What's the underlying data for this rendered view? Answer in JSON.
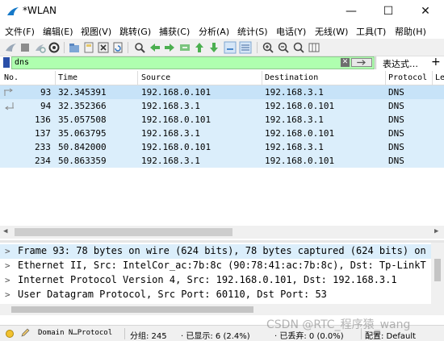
{
  "window": {
    "title": "*WLAN",
    "minimize": "—",
    "maximize": "☐",
    "close": "✕"
  },
  "menu": [
    {
      "label": "文件(F)"
    },
    {
      "label": "编辑(E)"
    },
    {
      "label": "视图(V)"
    },
    {
      "label": "跳转(G)"
    },
    {
      "label": "捕获(C)"
    },
    {
      "label": "分析(A)"
    },
    {
      "label": "统计(S)"
    },
    {
      "label": "电话(Y)"
    },
    {
      "label": "无线(W)"
    },
    {
      "label": "工具(T)"
    },
    {
      "label": "帮助(H)"
    }
  ],
  "filter": {
    "value": "dns",
    "expression_label": "表达式…",
    "plus": "+",
    "clear": "✕"
  },
  "columns": {
    "no": "No.",
    "time": "Time",
    "source": "Source",
    "destination": "Destination",
    "protocol": "Protocol",
    "length": "Le"
  },
  "packets": [
    {
      "no": "93",
      "time": "32.345391",
      "source": "192.168.0.101",
      "destination": "192.168.3.1",
      "protocol": "DNS"
    },
    {
      "no": "94",
      "time": "32.352366",
      "source": "192.168.3.1",
      "destination": "192.168.0.101",
      "protocol": "DNS"
    },
    {
      "no": "136",
      "time": "35.057508",
      "source": "192.168.0.101",
      "destination": "192.168.3.1",
      "protocol": "DNS"
    },
    {
      "no": "137",
      "time": "35.063795",
      "source": "192.168.3.1",
      "destination": "192.168.0.101",
      "protocol": "DNS"
    },
    {
      "no": "233",
      "time": "50.842000",
      "source": "192.168.0.101",
      "destination": "192.168.3.1",
      "protocol": "DNS"
    },
    {
      "no": "234",
      "time": "50.863359",
      "source": "192.168.3.1",
      "destination": "192.168.0.101",
      "protocol": "DNS"
    }
  ],
  "details": [
    "Frame 93: 78 bytes on wire (624 bits), 78 bytes captured (624 bits) on",
    "Ethernet II, Src: IntelCor_ac:7b:8c (90:78:41:ac:7b:8c), Dst: Tp-LinkT",
    "Internet Protocol Version 4, Src: 192.168.0.101, Dst: 192.168.3.1",
    "User Datagram Protocol, Src Port: 60110, Dst Port: 53"
  ],
  "status": {
    "profile_name": "Domain N…Protocol",
    "packets": "分组: 245",
    "displayed": "· 已显示: 6 (2.4%)",
    "dropped": "· 已丢弃: 0 (0.0%)",
    "config": "配置: Default"
  },
  "watermark": "CSDN @RTC_程序猿_wang",
  "colors": {
    "selected_row": "#c7e3f8",
    "filter_ok": "#afffaf",
    "row_dns": "#dbeefb"
  }
}
